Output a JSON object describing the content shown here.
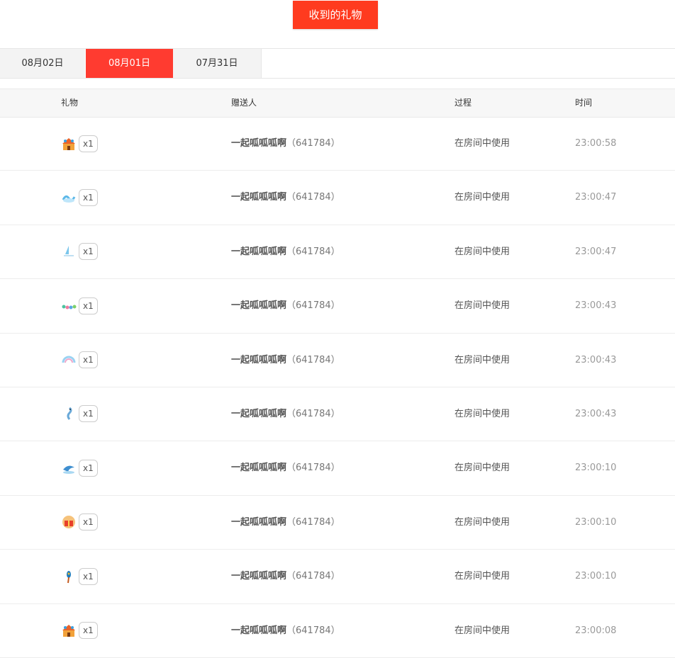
{
  "header": {
    "title_button": "收到的礼物"
  },
  "tabs": [
    {
      "label": "08月02日",
      "active": false
    },
    {
      "label": "08月01日",
      "active": true
    },
    {
      "label": "07月31日",
      "active": false
    }
  ],
  "table": {
    "columns": [
      "礼物",
      "赠送人",
      "过程",
      "时间"
    ],
    "rows": [
      {
        "gift_icon": "castle-icon",
        "qty": "x1",
        "sender_name": "一起呱呱呱啊",
        "sender_id": "（641784）",
        "process": "在房间中使用",
        "time": "23:00:58"
      },
      {
        "gift_icon": "wave-ring-icon",
        "qty": "x1",
        "sender_name": "一起呱呱呱啊",
        "sender_id": "（641784）",
        "process": "在房间中使用",
        "time": "23:00:47"
      },
      {
        "gift_icon": "sailboat-icon",
        "qty": "x1",
        "sender_name": "一起呱呱呱啊",
        "sender_id": "（641784）",
        "process": "在房间中使用",
        "time": "23:00:47"
      },
      {
        "gift_icon": "flower-garland-icon",
        "qty": "x1",
        "sender_name": "一起呱呱呱啊",
        "sender_id": "（641784）",
        "process": "在房间中使用",
        "time": "23:00:43"
      },
      {
        "gift_icon": "rainbow-icon",
        "qty": "x1",
        "sender_name": "一起呱呱呱啊",
        "sender_id": "（641784）",
        "process": "在房间中使用",
        "time": "23:00:43"
      },
      {
        "gift_icon": "seahorse-icon",
        "qty": "x1",
        "sender_name": "一起呱呱呱啊",
        "sender_id": "（641784）",
        "process": "在房间中使用",
        "time": "23:00:43"
      },
      {
        "gift_icon": "dolphin-icon",
        "qty": "x1",
        "sender_name": "一起呱呱呱啊",
        "sender_id": "（641784）",
        "process": "在房间中使用",
        "time": "23:00:10"
      },
      {
        "gift_icon": "gift-box-icon",
        "qty": "x1",
        "sender_name": "一起呱呱呱啊",
        "sender_id": "（641784）",
        "process": "在房间中使用",
        "time": "23:00:10"
      },
      {
        "gift_icon": "peacock-feather-icon",
        "qty": "x1",
        "sender_name": "一起呱呱呱啊",
        "sender_id": "（641784）",
        "process": "在房间中使用",
        "time": "23:00:10"
      },
      {
        "gift_icon": "castle-icon",
        "qty": "x1",
        "sender_name": "一起呱呱呱啊",
        "sender_id": "（641784）",
        "process": "在房间中使用",
        "time": "23:00:08"
      }
    ]
  },
  "colors": {
    "accent": "#ff3b30",
    "button": "#ff3b1f"
  }
}
